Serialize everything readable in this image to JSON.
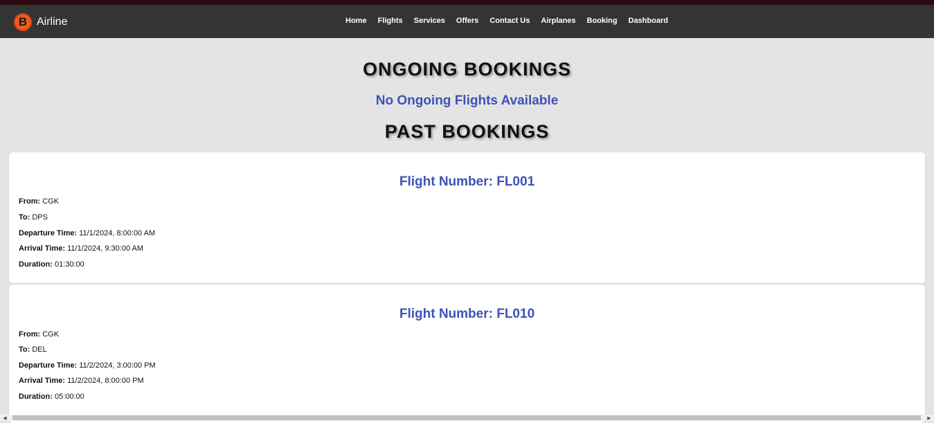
{
  "brand": {
    "logo_letter": "B",
    "name": "Airline"
  },
  "nav": {
    "links": [
      "Home",
      "Flights",
      "Services",
      "Offers",
      "Contact Us",
      "Airplanes",
      "Booking",
      "Dashboard"
    ]
  },
  "ongoing": {
    "heading": "ONGOING BOOKINGS",
    "empty_message": "No Ongoing Flights Available"
  },
  "past": {
    "heading": "PAST BOOKINGS",
    "bookings": [
      {
        "title": "Flight Number: FL001",
        "from_label": "From:",
        "from": "CGK",
        "to_label": "To:",
        "to": "DPS",
        "departure_label": "Departure Time:",
        "departure": "11/1/2024, 8:00:00 AM",
        "arrival_label": "Arrival Time:",
        "arrival": "11/1/2024, 9:30:00 AM",
        "duration_label": "Duration:",
        "duration": "01:30:00"
      },
      {
        "title": "Flight Number: FL010",
        "from_label": "From:",
        "from": "CGK",
        "to_label": "To:",
        "to": "DEL",
        "departure_label": "Departure Time:",
        "departure": "11/2/2024, 3:00:00 PM",
        "arrival_label": "Arrival Time:",
        "arrival": "11/2/2024, 8:00:00 PM",
        "duration_label": "Duration:",
        "duration": "05:00:00"
      }
    ]
  },
  "colors": {
    "navbar": "#343434",
    "accent_blue": "#3f51b5",
    "logo_orange": "#f25a1f",
    "background": "#e4e4e4"
  }
}
